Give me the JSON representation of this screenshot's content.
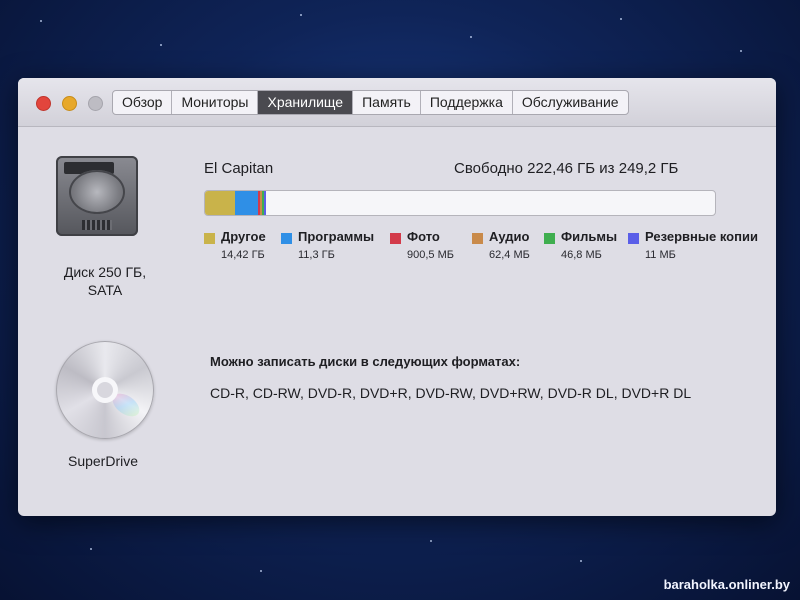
{
  "window": {
    "tabs": [
      {
        "label": "Обзор",
        "active": false
      },
      {
        "label": "Мониторы",
        "active": false
      },
      {
        "label": "Хранилище",
        "active": true
      },
      {
        "label": "Память",
        "active": false
      },
      {
        "label": "Поддержка",
        "active": false
      },
      {
        "label": "Обслуживание",
        "active": false
      }
    ]
  },
  "devices": {
    "disk": {
      "name_line1": "Диск 250 ГБ,",
      "name_line2": "SATA",
      "icon": "hard-drive-icon"
    },
    "optical": {
      "name": "SuperDrive",
      "icon": "disc-icon"
    }
  },
  "volume": {
    "name": "El Capitan",
    "free_text": "Свободно 222,46 ГБ из 249,2 ГБ",
    "total_gb": 249.2,
    "free_gb": 222.46
  },
  "usage": [
    {
      "key": "other",
      "label": "Другое",
      "size": "14,42 ГБ",
      "gb": 14.42,
      "color": "#c9b34a"
    },
    {
      "key": "apps",
      "label": "Программы",
      "size": "11,3 ГБ",
      "gb": 11.3,
      "color": "#2f8fe6"
    },
    {
      "key": "photos",
      "label": "Фото",
      "size": "900,5 МБ",
      "gb": 0.9005,
      "color": "#d33a4a"
    },
    {
      "key": "audio",
      "label": "Аудио",
      "size": "62,4 МБ",
      "gb": 0.0624,
      "color": "#c98a4a"
    },
    {
      "key": "movies",
      "label": "Фильмы",
      "size": "46,8 МБ",
      "gb": 0.0468,
      "color": "#3fae4f"
    },
    {
      "key": "backups",
      "label": "Резервные копии",
      "size": "11 МБ",
      "gb": 0.011,
      "color": "#5a5ee8"
    }
  ],
  "burn": {
    "title": "Можно записать диски в следующих форматах:",
    "formats": "CD-R, CD-RW, DVD-R, DVD+R, DVD-RW, DVD+RW, DVD-R DL, DVD+R DL"
  },
  "watermark": "baraholka.onliner.by",
  "colors": {
    "active_tab": "#4a4a50",
    "window_bg": "#dedde5"
  }
}
